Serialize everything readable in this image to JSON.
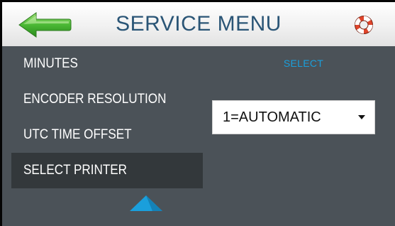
{
  "header": {
    "title": "SERVICE MENU",
    "back_icon": "back-arrow-icon",
    "help_icon": "lifebuoy-help-icon"
  },
  "menu": {
    "items": [
      {
        "label": "MINUTES",
        "selected": false
      },
      {
        "label": "ENCODER RESOLUTION",
        "selected": false
      },
      {
        "label": "UTC TIME OFFSET",
        "selected": false
      },
      {
        "label": "SELECT PRINTER",
        "selected": true
      }
    ],
    "scroll_icon": "scroll-up-icon"
  },
  "detail": {
    "select_label": "SELECT",
    "dropdown_value": "1=AUTOMATIC",
    "dropdown_icon": "chevron-down-icon"
  },
  "colors": {
    "background": "#4b5258",
    "selected_item": "#33383b",
    "title_text": "#2a5576",
    "select_label": "#1a9fdc",
    "back_arrow": "#3fa82c",
    "scroll_arrow": "#1a9fdc"
  }
}
